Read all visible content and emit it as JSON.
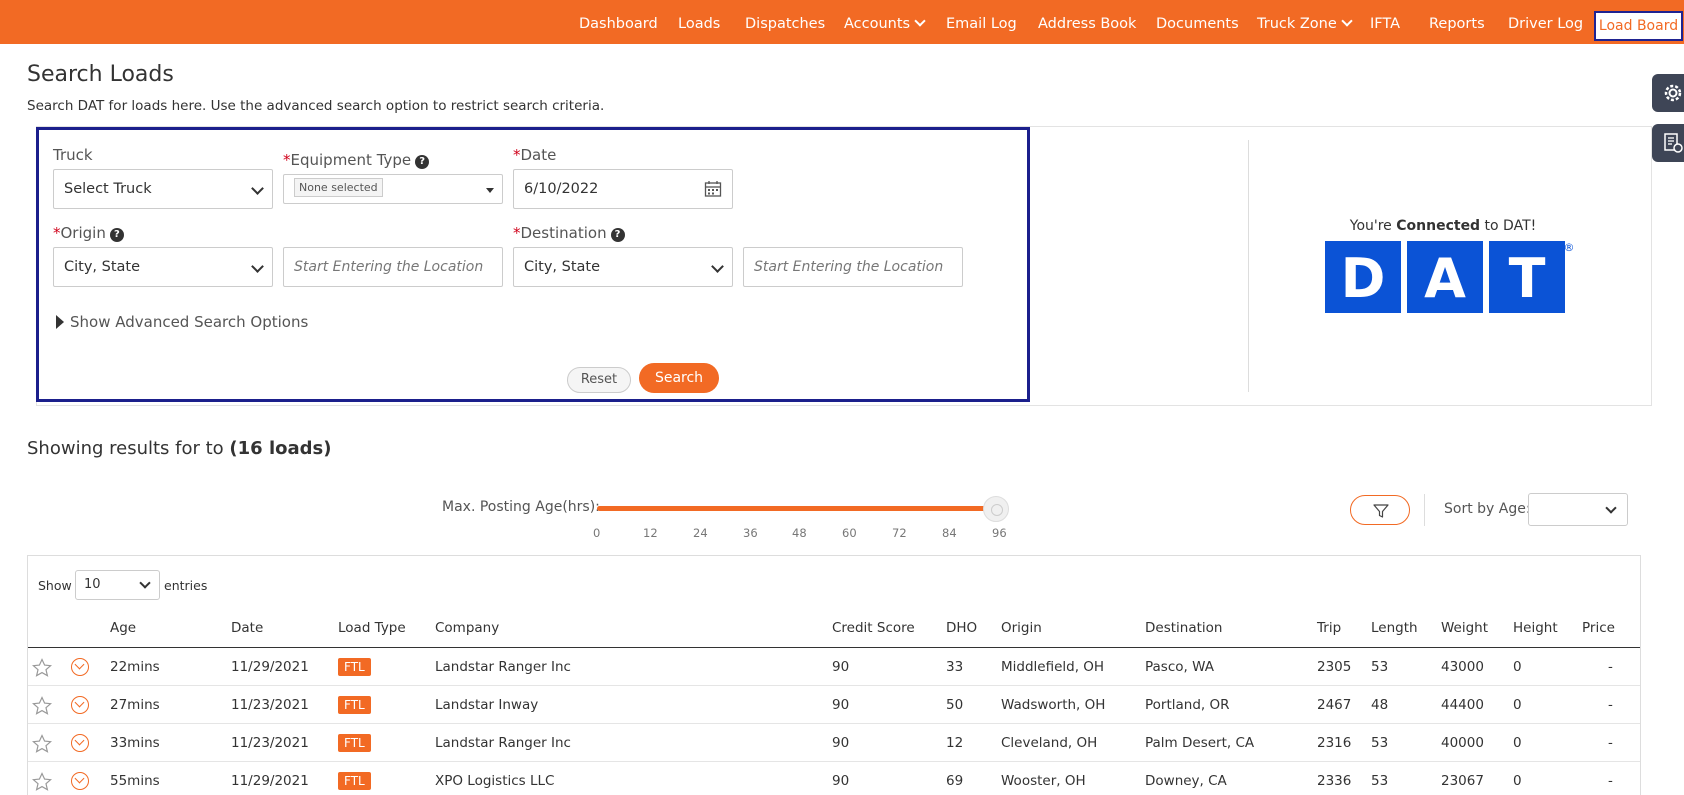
{
  "nav": {
    "items": [
      {
        "label": "Dashboard",
        "dropdown": false
      },
      {
        "label": "Loads",
        "dropdown": false
      },
      {
        "label": "Dispatches",
        "dropdown": false
      },
      {
        "label": "Accounts",
        "dropdown": true
      },
      {
        "label": "Email Log",
        "dropdown": false
      },
      {
        "label": "Address Book",
        "dropdown": false
      },
      {
        "label": "Documents",
        "dropdown": false
      },
      {
        "label": "Truck Zone",
        "dropdown": true
      },
      {
        "label": "IFTA",
        "dropdown": false
      },
      {
        "label": "Reports",
        "dropdown": false
      },
      {
        "label": "Driver Log",
        "dropdown": false
      }
    ],
    "active_label": "Load Board"
  },
  "page": {
    "title": "Search Loads",
    "subtitle": "Search DAT for loads here. Use the advanced search option to restrict search criteria."
  },
  "search": {
    "truck_label": "Truck",
    "truck_value": "Select Truck",
    "equipment_label": "Equipment Type",
    "equipment_value": "None selected",
    "date_label": "Date",
    "date_value": "6/10/2022",
    "origin_label": "Origin",
    "origin_value": "City, State",
    "origin_placeholder": "Start Entering the Location",
    "destination_label": "Destination",
    "destination_value": "City, State",
    "destination_placeholder": "Start Entering the Location",
    "required_mark": "*",
    "advanced_label": "Show Advanced Search Options",
    "reset_label": "Reset",
    "search_label": "Search"
  },
  "dat": {
    "connected_prefix": "You're ",
    "connected_bold": "Connected",
    "connected_suffix": " to DAT!",
    "letters": [
      "D",
      "A",
      "T"
    ],
    "registered": "®",
    "brand_color": "#0b53d6"
  },
  "results": {
    "prefix": "Showing results for to ",
    "count": "(16 loads)"
  },
  "slider": {
    "label": "Max. Posting Age(hrs):",
    "ticks": [
      "0",
      "12",
      "24",
      "36",
      "48",
      "60",
      "72",
      "84",
      "96"
    ],
    "value_fraction": 1.0
  },
  "sort": {
    "label": "Sort by Age:"
  },
  "table": {
    "show_label": "Show",
    "show_value": "10",
    "entries_label": "entries",
    "headers": [
      "Age",
      "Date",
      "Load Type",
      "Company",
      "Credit Score",
      "DHO",
      "Origin",
      "Destination",
      "Trip",
      "Length",
      "Weight",
      "Height",
      "Price"
    ],
    "rows": [
      {
        "age": "22mins",
        "date": "11/29/2021",
        "type": "FTL",
        "company": "Landstar Ranger Inc",
        "credit": "90",
        "dho": "33",
        "origin": "Middlefield, OH",
        "destination": "Pasco, WA",
        "trip": "2305",
        "length": "53",
        "weight": "43000",
        "height": "0",
        "price": "-"
      },
      {
        "age": "27mins",
        "date": "11/23/2021",
        "type": "FTL",
        "company": "Landstar Inway",
        "credit": "90",
        "dho": "50",
        "origin": "Wadsworth, OH",
        "destination": "Portland, OR",
        "trip": "2467",
        "length": "48",
        "weight": "44400",
        "height": "0",
        "price": "-"
      },
      {
        "age": "33mins",
        "date": "11/23/2021",
        "type": "FTL",
        "company": "Landstar Ranger Inc",
        "credit": "90",
        "dho": "12",
        "origin": "Cleveland, OH",
        "destination": "Palm Desert, CA",
        "trip": "2316",
        "length": "53",
        "weight": "40000",
        "height": "0",
        "price": "-"
      },
      {
        "age": "55mins",
        "date": "11/29/2021",
        "type": "FTL",
        "company": "XPO Logistics LLC",
        "credit": "90",
        "dho": "69",
        "origin": "Wooster, OH",
        "destination": "Downey, CA",
        "trip": "2336",
        "length": "53",
        "weight": "23067",
        "height": "0",
        "price": "-"
      }
    ]
  },
  "colors": {
    "accent": "#f26a24",
    "highlight_border": "#1b1f8c"
  }
}
